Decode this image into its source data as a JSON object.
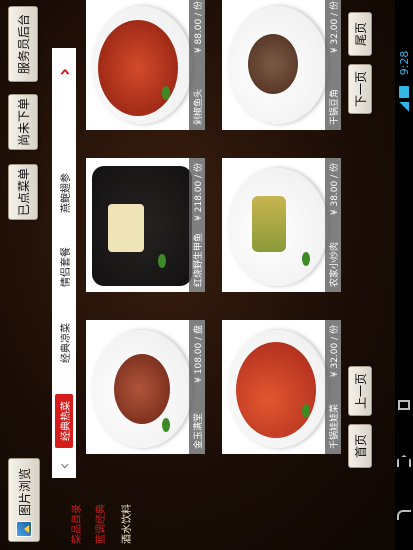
{
  "header": {
    "photo_browse": "图片浏览",
    "buttons": [
      "已点菜单",
      "尚未下单",
      "服务员后台"
    ]
  },
  "sidebar": {
    "items": [
      {
        "label": "菜品目录",
        "color": "#d21c1c"
      },
      {
        "label": "蓝调经典",
        "color": "#d21c1c"
      },
      {
        "label": "酒水饮料",
        "color": "#f2e6cc"
      }
    ]
  },
  "tabs": {
    "items": [
      "经典热菜",
      "经典凉菜",
      "情侣套餐",
      "燕鲍翅参"
    ],
    "active_index": 0,
    "left_arrow": "‹",
    "right_arrow": "›"
  },
  "dishes": [
    {
      "name": "金玉满堂",
      "price": "¥ 108.00 / 盘"
    },
    {
      "name": "红烧野生甲鱼",
      "price": "¥ 218.00 / 份"
    },
    {
      "name": "剁椒鱼头",
      "price": "¥ 88.00 / 份"
    },
    {
      "name": "千锅娃娃菜",
      "price": "¥ 32.00 / 份"
    },
    {
      "name": "农家小炒肉",
      "price": "¥ 38.00 / 份"
    },
    {
      "name": "干锅豆角",
      "price": "¥ 32.00 / 份"
    }
  ],
  "pager": {
    "first": "首页",
    "prev": "上一页",
    "next": "下一页",
    "last": "尾页"
  },
  "status_bar": {
    "time": "9:28",
    "colors": {
      "accent": "#33b5e5"
    }
  },
  "nav_icons": [
    "back-icon",
    "home-icon",
    "recents-icon"
  ]
}
